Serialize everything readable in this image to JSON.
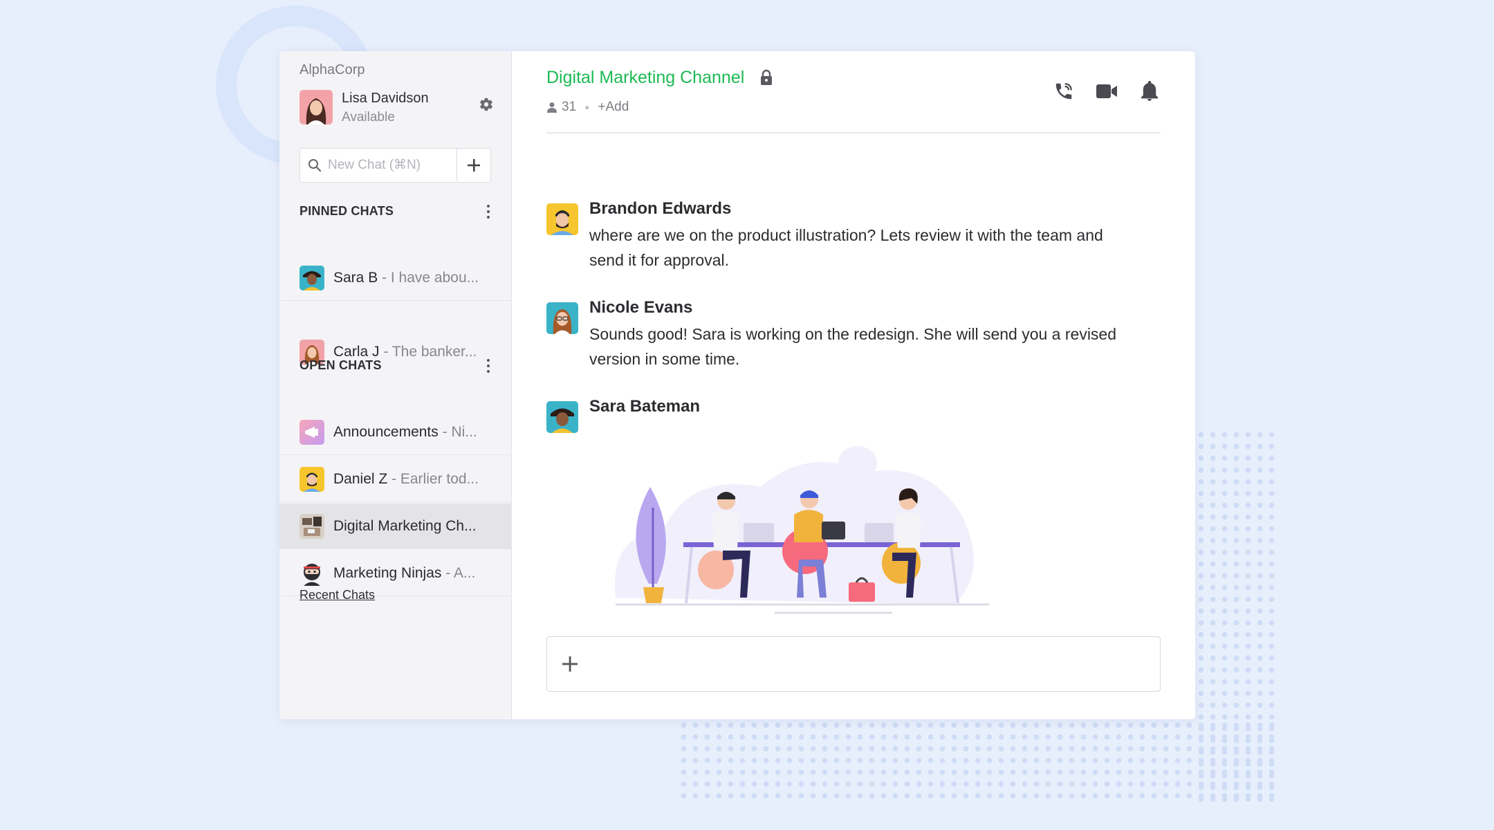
{
  "org": "AlphaCorp",
  "user": {
    "name": "Lisa Davidson",
    "status": "Available"
  },
  "search": {
    "placeholder": "New Chat (⌘N)"
  },
  "pinned": {
    "title": "PINNED CHATS",
    "items": [
      {
        "name": "Sara B",
        "preview": " - I have abou..."
      },
      {
        "name": "Carla J",
        "preview": " - The banker..."
      }
    ]
  },
  "open": {
    "title": "OPEN CHATS",
    "items": [
      {
        "name": "Announcements",
        "preview": " - Ni..."
      },
      {
        "name": "Daniel Z",
        "preview": " - Earlier tod..."
      },
      {
        "name": "Digital Marketing Ch...",
        "preview": ""
      },
      {
        "name": "Marketing Ninjas",
        "preview": " - A..."
      }
    ]
  },
  "recent_link": "Recent Chats",
  "channel": {
    "title": "Digital Marketing Channel",
    "members": "31",
    "add_label": "+Add"
  },
  "icons": {
    "settings": "gear-icon",
    "search": "search-icon",
    "lock": "lock-icon",
    "call": "phone-icon",
    "video": "video-camera-icon",
    "notify": "bell-icon"
  },
  "messages": [
    {
      "name": "Brandon Edwards",
      "text": "where are we on the product illustration? Lets review it with the team and send it for approval."
    },
    {
      "name": "Nicole Evans",
      "text": "Sounds good! Sara is working on the redesign. She will send you a revised version in some time."
    },
    {
      "name": "Sara Bateman",
      "text": ""
    }
  ],
  "colors": {
    "accent": "#1db954",
    "background": "#e8effc",
    "sidebar": "#f4f4f6"
  }
}
